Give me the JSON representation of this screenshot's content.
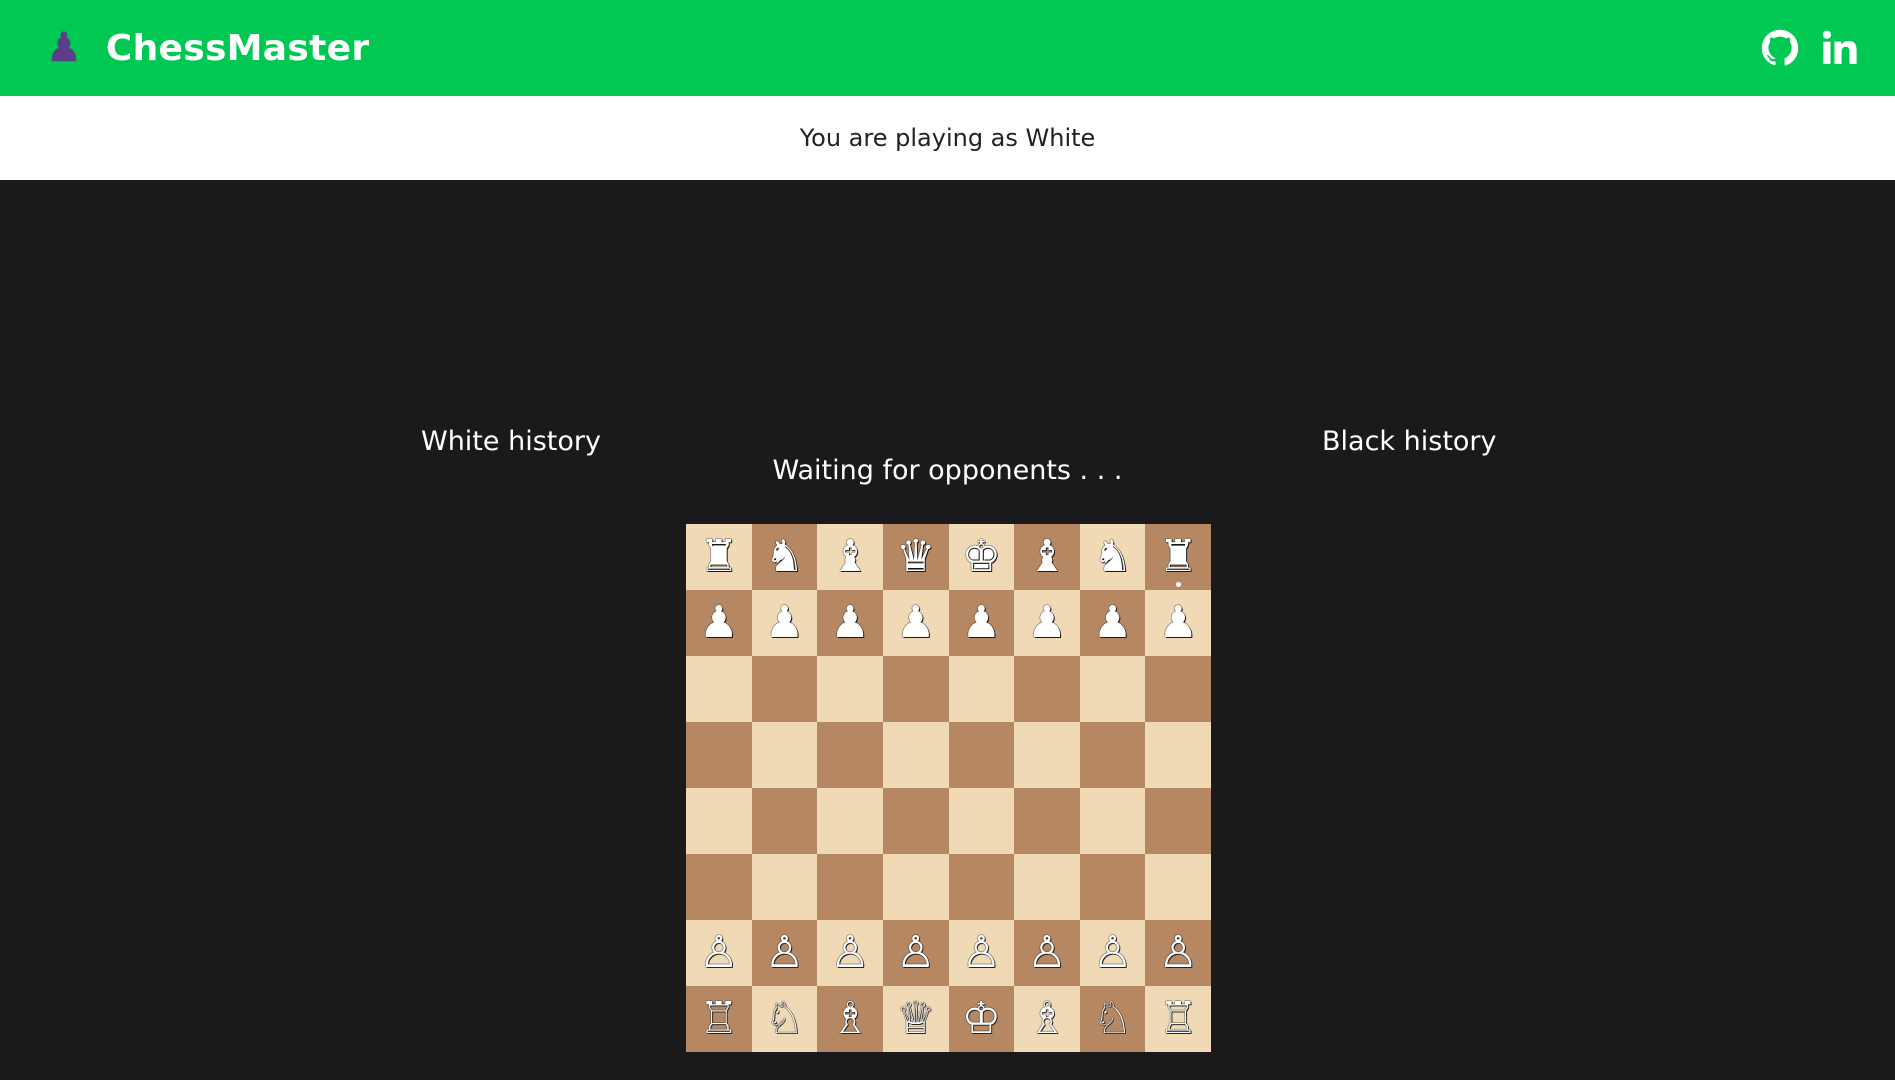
{
  "navbar": {
    "brand_icon": "♟",
    "title": "ChessMaster",
    "links": [
      {
        "name": "github-icon"
      },
      {
        "name": "linkedin-icon",
        "text": "in"
      }
    ],
    "colors": {
      "background": "#00c853",
      "brand_icon": "#5b3d8a"
    }
  },
  "subheader": {
    "text": "You are playing as White"
  },
  "history": {
    "white_title": "White history",
    "black_title": "Black history"
  },
  "status": {
    "text": "Waiting for opponents . . ."
  },
  "board": {
    "colors": {
      "light": "#f0d9b5",
      "dark": "#b58863"
    },
    "rows": [
      [
        "♜",
        "♞",
        "♝",
        "♛",
        "♚",
        "♝",
        "♞",
        "♜"
      ],
      [
        "♟",
        "♟",
        "♟",
        "♟",
        "♟",
        "♟",
        "♟",
        "♟"
      ],
      [
        "",
        "",
        "",
        "",
        "",
        "",
        "",
        ""
      ],
      [
        "",
        "",
        "",
        "",
        "",
        "",
        "",
        ""
      ],
      [
        "",
        "",
        "",
        "",
        "",
        "",
        "",
        ""
      ],
      [
        "",
        "",
        "",
        "",
        "",
        "",
        "",
        ""
      ],
      [
        "♙",
        "♙",
        "♙",
        "♙",
        "♙",
        "♙",
        "♙",
        "♙"
      ],
      [
        "♖",
        "♘",
        "♗",
        "♕",
        "♔",
        "♗",
        "♘",
        "♖"
      ]
    ]
  }
}
